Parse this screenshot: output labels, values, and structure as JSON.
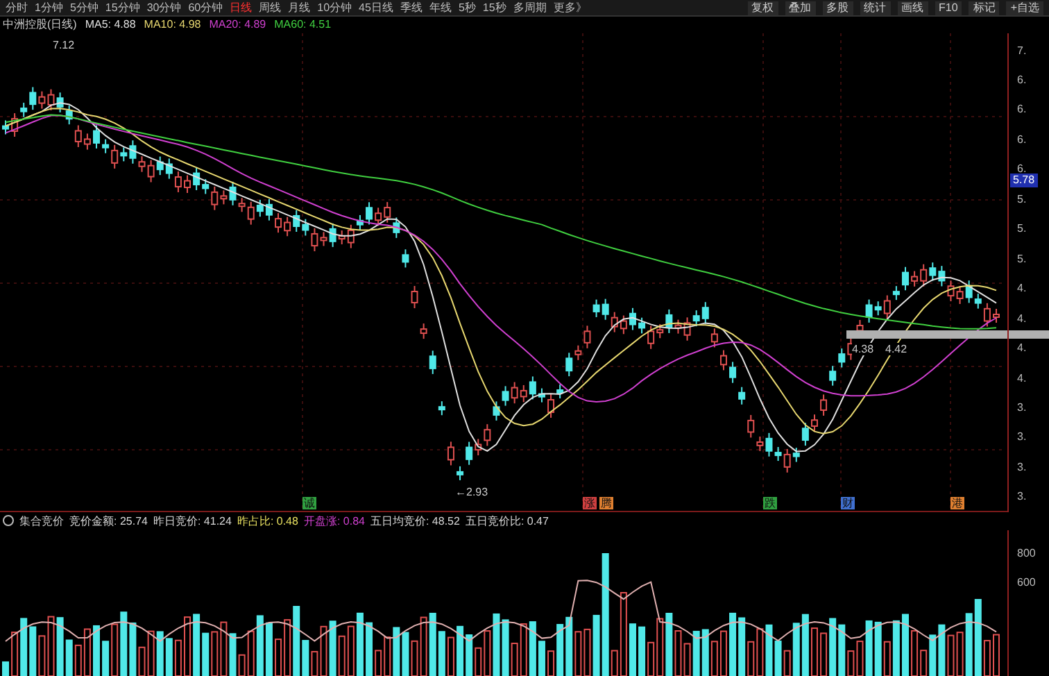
{
  "toolbar": {
    "periods": [
      {
        "label": "分时",
        "selected": false
      },
      {
        "label": "1分钟",
        "selected": false
      },
      {
        "label": "5分钟",
        "selected": false
      },
      {
        "label": "15分钟",
        "selected": false
      },
      {
        "label": "30分钟",
        "selected": false
      },
      {
        "label": "60分钟",
        "selected": false
      },
      {
        "label": "日线",
        "selected": true
      },
      {
        "label": "周线",
        "selected": false
      },
      {
        "label": "月线",
        "selected": false
      },
      {
        "label": "10分钟",
        "selected": false
      },
      {
        "label": "45日线",
        "selected": false
      },
      {
        "label": "季线",
        "selected": false
      },
      {
        "label": "年线",
        "selected": false
      },
      {
        "label": "5秒",
        "selected": false
      },
      {
        "label": "15秒",
        "selected": false
      },
      {
        "label": "多周期",
        "selected": false
      },
      {
        "label": "更多》",
        "selected": false
      }
    ],
    "actions": [
      "复权",
      "叠加",
      "多股",
      "统计",
      "画线",
      "F10",
      "标记",
      "+自选"
    ]
  },
  "header": {
    "title": "中洲控股(日线)",
    "ma": [
      {
        "label": "MA5: 4.88",
        "color": "#e0e0e0"
      },
      {
        "label": "MA10: 4.98",
        "color": "#e8d870"
      },
      {
        "label": "MA20: 4.89",
        "color": "#d040d0"
      },
      {
        "label": "MA60: 4.51",
        "color": "#40d040"
      }
    ]
  },
  "price_chart": {
    "high_label": "7.12",
    "low_label": "←2.93",
    "last_price": "5.78",
    "range_labels": [
      "4.38",
      "4.42"
    ],
    "axis_labels": [
      "7.",
      "6.",
      "6.",
      "6.",
      "6.",
      "5.",
      "5.",
      "5.",
      "4.",
      "4.",
      "4.",
      "4.",
      "3.",
      "3.",
      "3.",
      "3."
    ],
    "events": [
      {
        "label": "诚",
        "color": "#30a040"
      },
      {
        "label": "涨",
        "color": "#d04040"
      },
      {
        "label": "腾",
        "color": "#e08030"
      },
      {
        "label": "跌",
        "color": "#30a040"
      },
      {
        "label": "财",
        "color": "#4070d0"
      },
      {
        "label": "港",
        "color": "#e08030"
      }
    ]
  },
  "auction_panel": {
    "title": "集合竞价",
    "stats": [
      {
        "label": "竞价金额: 25.74",
        "color": "#d8d8d8"
      },
      {
        "label": "昨日竞价: 41.24",
        "color": "#d8d8d8"
      },
      {
        "label": "昨占比: 0.48",
        "color": "#e8e060"
      },
      {
        "label": "开盘涨: 0.84",
        "color": "#d040d0"
      },
      {
        "label": "五日均竞价: 48.52",
        "color": "#d8d8d8"
      },
      {
        "label": "五日竞价比: 0.47",
        "color": "#d8d8d8"
      }
    ],
    "axis_labels": [
      "800",
      "600"
    ]
  }
}
